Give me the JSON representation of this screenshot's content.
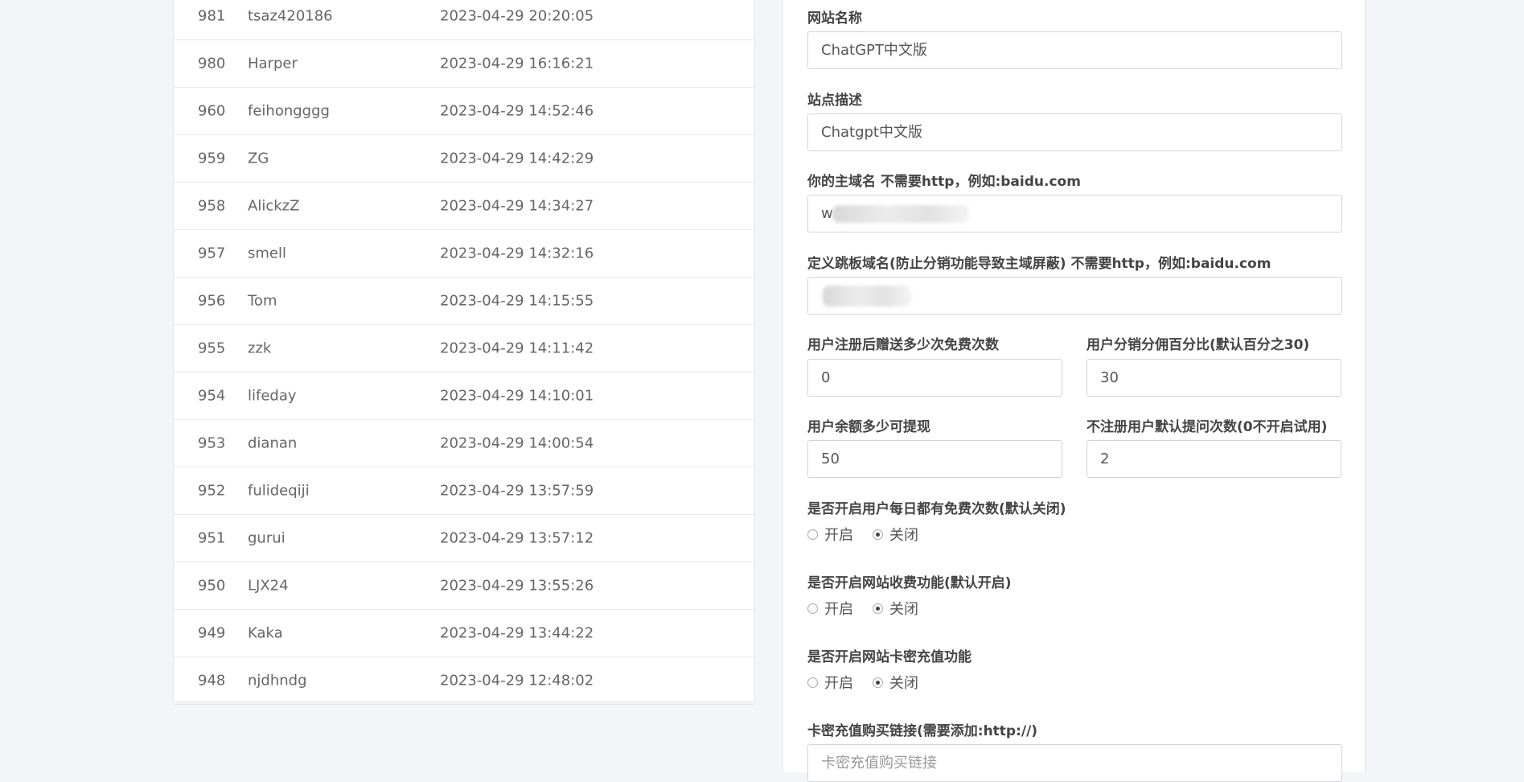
{
  "users": [
    {
      "id": "981",
      "name": "tsaz420186",
      "time": "2023-04-29 20:20:05"
    },
    {
      "id": "980",
      "name": "Harper",
      "time": "2023-04-29 16:16:21"
    },
    {
      "id": "960",
      "name": "feihongggg",
      "time": "2023-04-29 14:52:46"
    },
    {
      "id": "959",
      "name": "ZG",
      "time": "2023-04-29 14:42:29"
    },
    {
      "id": "958",
      "name": "AlickzZ",
      "time": "2023-04-29 14:34:27"
    },
    {
      "id": "957",
      "name": "smell",
      "time": "2023-04-29 14:32:16"
    },
    {
      "id": "956",
      "name": "Tom",
      "time": "2023-04-29 14:15:55"
    },
    {
      "id": "955",
      "name": "zzk",
      "time": "2023-04-29 14:11:42"
    },
    {
      "id": "954",
      "name": "lifeday",
      "time": "2023-04-29 14:10:01"
    },
    {
      "id": "953",
      "name": "dianan",
      "time": "2023-04-29 14:00:54"
    },
    {
      "id": "952",
      "name": "fulideqiji",
      "time": "2023-04-29 13:57:59"
    },
    {
      "id": "951",
      "name": "gurui",
      "time": "2023-04-29 13:57:12"
    },
    {
      "id": "950",
      "name": "LJX24",
      "time": "2023-04-29 13:55:26"
    },
    {
      "id": "949",
      "name": "Kaka",
      "time": "2023-04-29 13:44:22"
    },
    {
      "id": "948",
      "name": "njdhndg",
      "time": "2023-04-29 12:48:02"
    }
  ],
  "settings": {
    "site_name": {
      "label": "网站名称",
      "value": "ChatGPT中文版"
    },
    "site_desc": {
      "label": "站点描述",
      "value": "Chatgpt中文版"
    },
    "main_domain": {
      "label": "你的主域名 不需要http，例如:baidu.com",
      "value": "w"
    },
    "jump_domain": {
      "label": "定义跳板域名(防止分销功能导致主域屏蔽) 不需要http，例如:baidu.com",
      "value": ""
    },
    "register_free": {
      "label": "用户注册后赠送多少次免费次数",
      "value": "0"
    },
    "commission": {
      "label": "用户分销分佣百分比(默认百分之30)",
      "value": "30"
    },
    "withdraw_min": {
      "label": "用户余额多少可提现",
      "value": "50"
    },
    "guest_questions": {
      "label": "不注册用户默认提问次数(0不开启试用)",
      "value": "2"
    },
    "daily_free": {
      "label": "是否开启用户每日都有免费次数(默认关闭)",
      "on": "开启",
      "off": "关闭",
      "selected": "off"
    },
    "charge": {
      "label": "是否开启网站收费功能(默认开启)",
      "on": "开启",
      "off": "关闭",
      "selected": "off"
    },
    "card_recharge": {
      "label": "是否开启网站卡密充值功能",
      "on": "开启",
      "off": "关闭",
      "selected": "off"
    },
    "card_link": {
      "label": "卡密充值购买链接(需要添加:http://)",
      "placeholder": "卡密充值购买链接"
    }
  }
}
